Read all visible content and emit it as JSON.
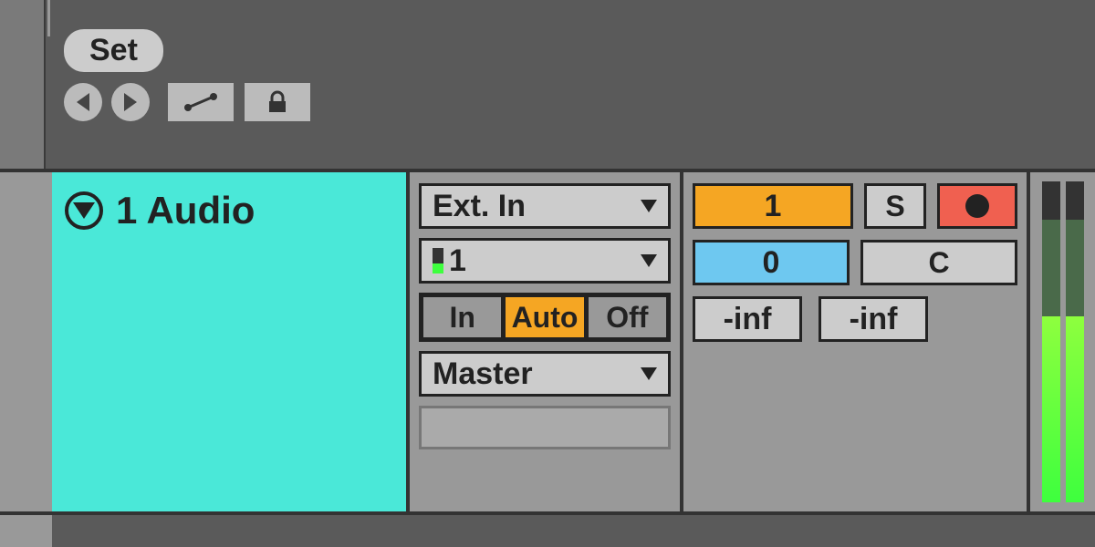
{
  "header": {
    "set_label": "Set"
  },
  "track": {
    "name": "1 Audio",
    "io": {
      "input_type": "Ext. In",
      "input_channel": "1",
      "output": "Master"
    },
    "monitor": {
      "in_label": "In",
      "auto_label": "Auto",
      "off_label": "Off"
    },
    "mixer": {
      "activator": "1",
      "solo_label": "S",
      "pan_value": "0",
      "pan_right": "C",
      "volume_a": "-inf",
      "volume_b": "-inf"
    }
  },
  "colors": {
    "track_bg": "#4ae8d8",
    "accent_orange": "#f5a623",
    "accent_blue": "#6ec8f0",
    "accent_red": "#f06050"
  }
}
